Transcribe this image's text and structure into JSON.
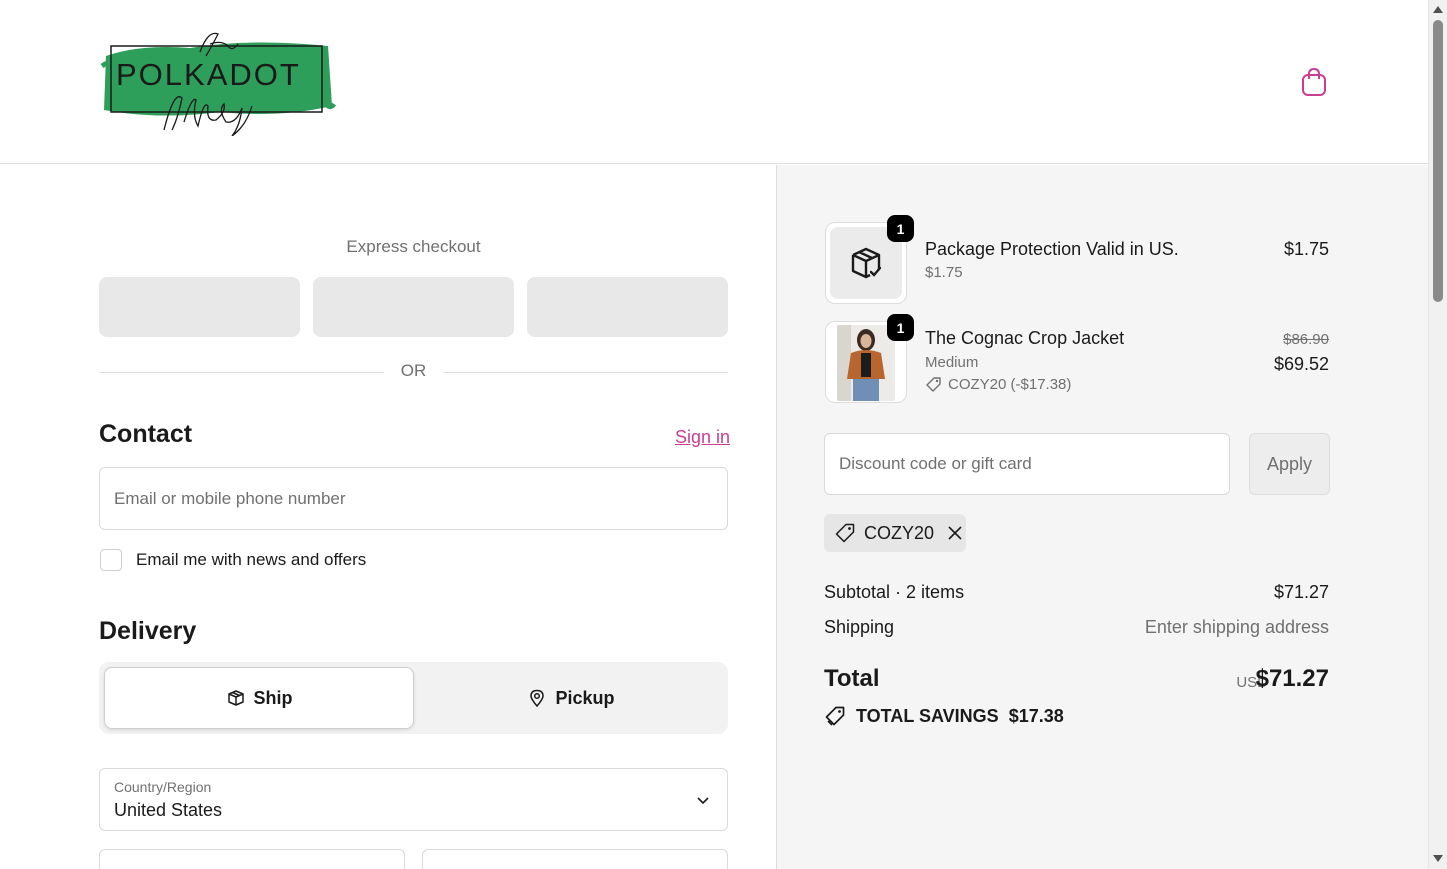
{
  "brand": {
    "logo_text": "POLKADOT",
    "logo_script_top": "The",
    "logo_script_bottom": "Alley",
    "logo_green": "#2e9e5b",
    "accent": "#c93e93"
  },
  "header": {
    "cart_icon": "shopping-bag-icon"
  },
  "express": {
    "title": "Express checkout",
    "or_label": "OR"
  },
  "contact": {
    "heading": "Contact",
    "sign_in": "Sign in",
    "email_placeholder": "Email or mobile phone number",
    "newsletter_label": "Email me with news and offers",
    "newsletter_checked": false
  },
  "delivery": {
    "heading": "Delivery",
    "options": [
      {
        "label": "Ship",
        "icon": "box-icon",
        "selected": true
      },
      {
        "label": "Pickup",
        "icon": "map-pin-icon",
        "selected": false
      }
    ],
    "country_label": "Country/Region",
    "country_value": "United States"
  },
  "cart": {
    "items": [
      {
        "name": "Package Protection Valid in US.",
        "sub": "$1.75",
        "price": "$1.75",
        "qty": "1",
        "icon": "package-check-icon"
      },
      {
        "name": "The Cognac Crop Jacket",
        "sub": "Medium",
        "original_price": "$86.90",
        "price": "$69.52",
        "qty": "1",
        "discount": "COZY20 (-$17.38)"
      }
    ],
    "discount_placeholder": "Discount code or gift card",
    "apply_label": "Apply",
    "applied_code": "COZY20",
    "subtotal_label": "Subtotal · 2 items",
    "subtotal_value": "$71.27",
    "shipping_label": "Shipping",
    "shipping_value": "Enter shipping address",
    "total_label": "Total",
    "total_currency": "USD",
    "total_value": "$71.27",
    "savings_label": "TOTAL SAVINGS",
    "savings_value": "$17.38"
  }
}
